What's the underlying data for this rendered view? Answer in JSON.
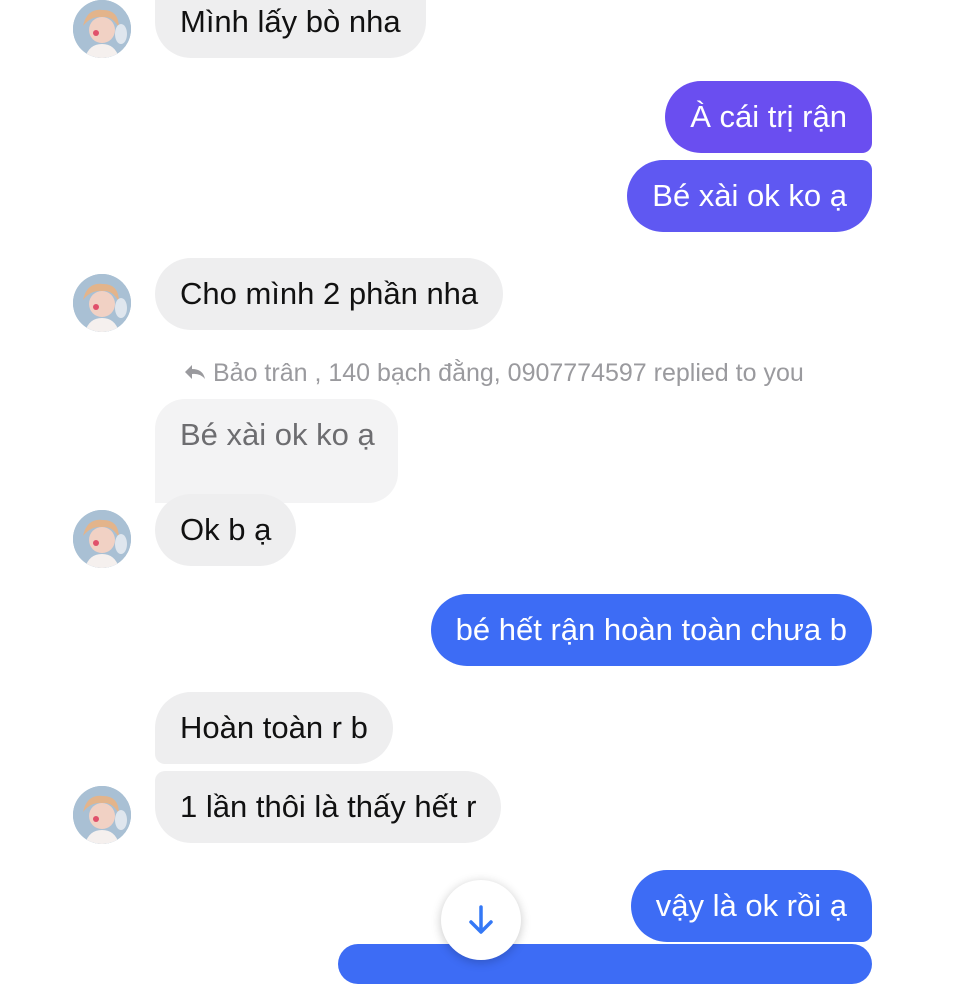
{
  "messages": [
    {
      "id": "m1",
      "side": "in",
      "text": "Mình lấy bò nha"
    },
    {
      "id": "m2",
      "side": "out",
      "text": "À cái trị rận"
    },
    {
      "id": "m3",
      "side": "out",
      "text": "Bé xài ok ko ạ"
    },
    {
      "id": "m4",
      "side": "in",
      "text": "Cho mình 2 phần nha"
    },
    {
      "id": "m5",
      "side": "in",
      "reply_label": "Bảo trân , 140 bạch đằng, 0907774597 replied to you",
      "quoted_text": "Bé xài ok ko ạ",
      "text": "Ok b ạ"
    },
    {
      "id": "m6",
      "side": "out",
      "text": "bé hết rận hoàn toàn chưa b"
    },
    {
      "id": "m7",
      "side": "in",
      "text": "Hoàn toàn r b"
    },
    {
      "id": "m8",
      "side": "in",
      "text": "1 lần thôi là thấy hết r"
    },
    {
      "id": "m9",
      "side": "out",
      "text": "vậy là ok rồi ạ"
    }
  ],
  "icons": {
    "reply": "reply-arrow-icon",
    "scroll": "arrow-down-icon",
    "avatar": "contact-avatar"
  },
  "colors": {
    "outgoing_purple": "#6a4ef0",
    "outgoing_blue": "#3d6cf5",
    "incoming": "#eeeeef",
    "scroll_arrow": "#3478f6"
  }
}
